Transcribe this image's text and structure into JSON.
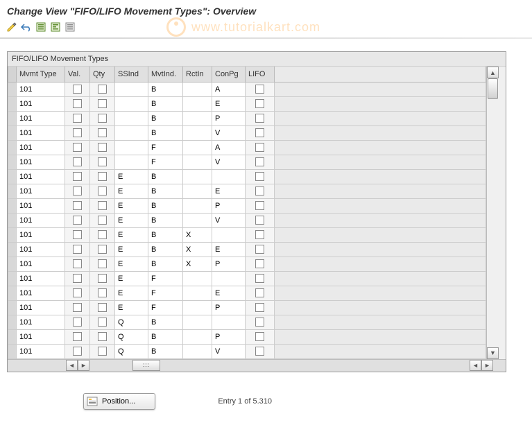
{
  "title": "Change View \"FIFO/LIFO Movement Types\": Overview",
  "watermark": "www.tutorialkart.com",
  "table": {
    "title": "FIFO/LIFO Movement Types",
    "columns": {
      "mvmt": "Mvmt Type",
      "val": "Val.",
      "qty": "Qty",
      "ssind": "SSInd",
      "mvtind": "MvtInd.",
      "rctin": "RctIn",
      "conpg": "ConPg",
      "lifo": "LIFO"
    },
    "rows": [
      {
        "mvmt": "101",
        "ssind": "",
        "mvtind": "B",
        "rctin": "",
        "conpg": "A"
      },
      {
        "mvmt": "101",
        "ssind": "",
        "mvtind": "B",
        "rctin": "",
        "conpg": "E"
      },
      {
        "mvmt": "101",
        "ssind": "",
        "mvtind": "B",
        "rctin": "",
        "conpg": "P"
      },
      {
        "mvmt": "101",
        "ssind": "",
        "mvtind": "B",
        "rctin": "",
        "conpg": "V"
      },
      {
        "mvmt": "101",
        "ssind": "",
        "mvtind": "F",
        "rctin": "",
        "conpg": "A"
      },
      {
        "mvmt": "101",
        "ssind": "",
        "mvtind": "F",
        "rctin": "",
        "conpg": "V"
      },
      {
        "mvmt": "101",
        "ssind": "E",
        "mvtind": "B",
        "rctin": "",
        "conpg": ""
      },
      {
        "mvmt": "101",
        "ssind": "E",
        "mvtind": "B",
        "rctin": "",
        "conpg": "E"
      },
      {
        "mvmt": "101",
        "ssind": "E",
        "mvtind": "B",
        "rctin": "",
        "conpg": "P"
      },
      {
        "mvmt": "101",
        "ssind": "E",
        "mvtind": "B",
        "rctin": "",
        "conpg": "V"
      },
      {
        "mvmt": "101",
        "ssind": "E",
        "mvtind": "B",
        "rctin": "X",
        "conpg": ""
      },
      {
        "mvmt": "101",
        "ssind": "E",
        "mvtind": "B",
        "rctin": "X",
        "conpg": "E"
      },
      {
        "mvmt": "101",
        "ssind": "E",
        "mvtind": "B",
        "rctin": "X",
        "conpg": "P"
      },
      {
        "mvmt": "101",
        "ssind": "E",
        "mvtind": "F",
        "rctin": "",
        "conpg": ""
      },
      {
        "mvmt": "101",
        "ssind": "E",
        "mvtind": "F",
        "rctin": "",
        "conpg": "E"
      },
      {
        "mvmt": "101",
        "ssind": "E",
        "mvtind": "F",
        "rctin": "",
        "conpg": "P"
      },
      {
        "mvmt": "101",
        "ssind": "Q",
        "mvtind": "B",
        "rctin": "",
        "conpg": ""
      },
      {
        "mvmt": "101",
        "ssind": "Q",
        "mvtind": "B",
        "rctin": "",
        "conpg": "P"
      },
      {
        "mvmt": "101",
        "ssind": "Q",
        "mvtind": "B",
        "rctin": "",
        "conpg": "V"
      }
    ]
  },
  "footer": {
    "position_label": "Position...",
    "entry_text": "Entry 1 of 5.310"
  }
}
